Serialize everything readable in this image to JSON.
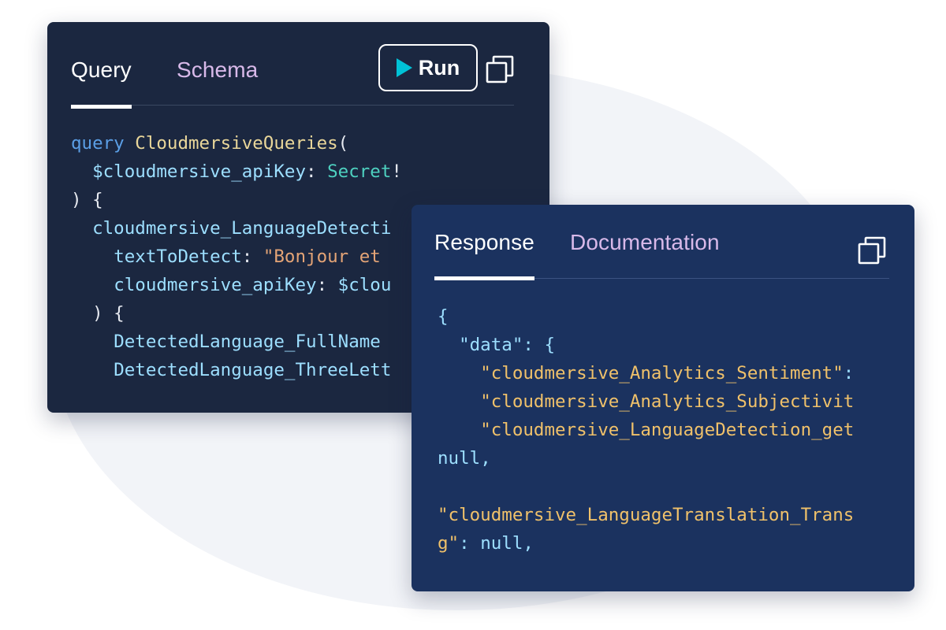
{
  "query_panel": {
    "tabs": {
      "query": "Query",
      "schema": "Schema"
    },
    "run_label": "Run",
    "code": {
      "l1_kw": "query",
      "l1_name": "CloudmersiveQueries",
      "l1_paren": "(",
      "l2_indent": "  ",
      "l2_var": "$cloudmersive_apiKey",
      "l2_colon": ": ",
      "l2_type": "Secret",
      "l2_bang": "!",
      "l3": ") {",
      "l4_indent": "  ",
      "l4_field": "cloudmersive_LanguageDetecti",
      "l5_indent": "    ",
      "l5_arg": "textToDetect",
      "l5_colon": ": ",
      "l5_str": "\"Bonjour et",
      "l6_indent": "    ",
      "l6_arg": "cloudmersive_apiKey",
      "l6_colon": ": ",
      "l6_var": "$clou",
      "l7": "  ) {",
      "l8_indent": "    ",
      "l8_field": "DetectedLanguage_FullName",
      "l9_indent": "    ",
      "l9_field": "DetectedLanguage_ThreeLett"
    }
  },
  "response_panel": {
    "tabs": {
      "response": "Response",
      "documentation": "Documentation"
    },
    "code": {
      "l1": "{",
      "l2_indent": "  ",
      "l2_key": "\"data\"",
      "l2_rest": ": {",
      "l3_indent": "    ",
      "l3_str": "\"cloudmersive_Analytics_Sentiment\"",
      "l3_colon": ":",
      "l4_indent": "    ",
      "l4_str": "\"cloudmersive_Analytics_Subjectivit",
      "l5_indent": "    ",
      "l5_str": "\"cloudmersive_LanguageDetection_get",
      "l6_null": "null",
      "l6_comma": ",",
      "l7": "",
      "l8_str": "\"cloudmersive_LanguageTranslation_Trans",
      "l9_str": "g\"",
      "l9_colon": ": ",
      "l9_null": "null",
      "l9_comma": ","
    }
  },
  "colors": {
    "query_bg": "#1b2740",
    "response_bg": "#1b325f",
    "accent_play": "#00c2d6",
    "inactive_tab": "#d8b9e9"
  },
  "icons": [
    "play-icon",
    "copy-icon"
  ]
}
